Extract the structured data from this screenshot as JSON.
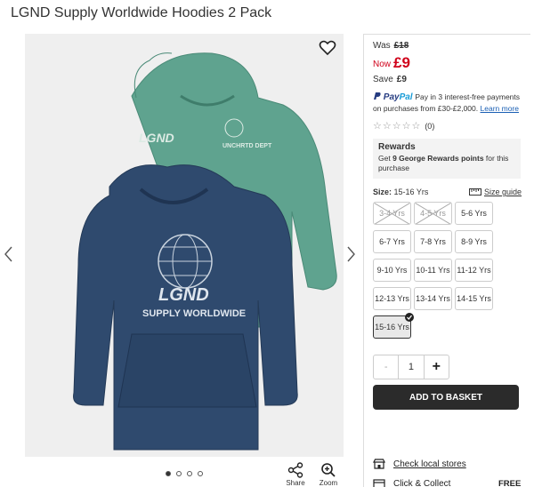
{
  "product": {
    "title": "LGND Supply Worldwide Hoodies 2 Pack"
  },
  "price": {
    "was_label": "Was",
    "was_value": "£18",
    "now_label": "Now",
    "now_value": "£9",
    "save_label": "Save",
    "save_value": "£9",
    "accent": "#d0021b"
  },
  "paypal": {
    "logo_p1": "Pay",
    "logo_p2": "Pal",
    "text": "Pay in 3 interest-free payments on purchases from £30-£2,000.",
    "learn_more": "Learn more"
  },
  "rating": {
    "stars": "☆☆☆☆☆",
    "count": "(0)"
  },
  "rewards": {
    "heading": "Rewards",
    "text_pre": "Get ",
    "points": "9 George Rewards points",
    "text_post": " for this purchase"
  },
  "size": {
    "label": "Size:",
    "selected": "15-16 Yrs",
    "guide": "Size guide",
    "options": [
      {
        "label": "3-4 Yrs",
        "state": "out-of-stock"
      },
      {
        "label": "4-5 Yrs",
        "state": "out-of-stock"
      },
      {
        "label": "5-6 Yrs",
        "state": "available"
      },
      {
        "label": "6-7 Yrs",
        "state": "available"
      },
      {
        "label": "7-8 Yrs",
        "state": "available"
      },
      {
        "label": "8-9 Yrs",
        "state": "available"
      },
      {
        "label": "9-10 Yrs",
        "state": "available"
      },
      {
        "label": "10-11 Yrs",
        "state": "available"
      },
      {
        "label": "11-12 Yrs",
        "state": "available"
      },
      {
        "label": "12-13 Yrs",
        "state": "available"
      },
      {
        "label": "13-14 Yrs",
        "state": "available"
      },
      {
        "label": "14-15 Yrs",
        "state": "available"
      },
      {
        "label": "15-16 Yrs",
        "state": "selected"
      }
    ]
  },
  "quantity": {
    "minus": "-",
    "value": "1",
    "plus": "+"
  },
  "basket": {
    "label": "ADD TO BASKET"
  },
  "delivery": {
    "stores_link": "Check local stores",
    "click_collect": "Click & Collect",
    "click_collect_price": "FREE"
  },
  "gallery": {
    "share_label": "Share",
    "zoom_label": "Zoom",
    "dots": [
      true,
      false,
      false,
      false
    ],
    "hoodie_front_print": [
      "LGND",
      "SUPPLY WORLDWIDE"
    ],
    "hoodie_back_print": [
      "LGND",
      "UNCHRTD DEPT"
    ],
    "icons": [
      "heart-icon",
      "chevron-left-icon",
      "chevron-right-icon",
      "share-icon",
      "zoom-icon",
      "store-icon",
      "click-collect-icon",
      "size-guide-ruler-icon"
    ]
  }
}
